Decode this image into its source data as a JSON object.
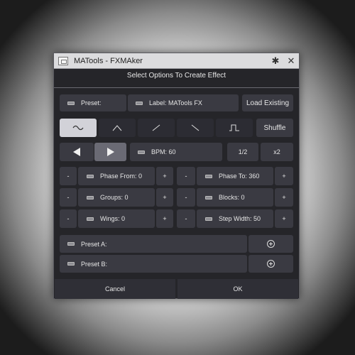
{
  "window": {
    "title": "MATools - FXMAker"
  },
  "dialog": {
    "title": "Select Options To Create Effect"
  },
  "row1": {
    "preset": "Preset:",
    "label": "Label: MATools FX",
    "load": "Load Existing"
  },
  "waveforms": {
    "shuffle": "Shuffle"
  },
  "tempo": {
    "bpm": "BPM: 60",
    "half": "1/2",
    "double": "x2"
  },
  "params": {
    "minus": "-",
    "plus": "+",
    "phase_from": "Phase From: 0",
    "phase_to": "Phase To: 360",
    "groups": "Groups: 0",
    "blocks": "Blocks: 0",
    "wings": "Wings: 0",
    "step_width": "Step Width: 50"
  },
  "presets": {
    "a": "Preset A:",
    "b": "Preset B:"
  },
  "footer": {
    "cancel": "Cancel",
    "ok": "OK"
  }
}
